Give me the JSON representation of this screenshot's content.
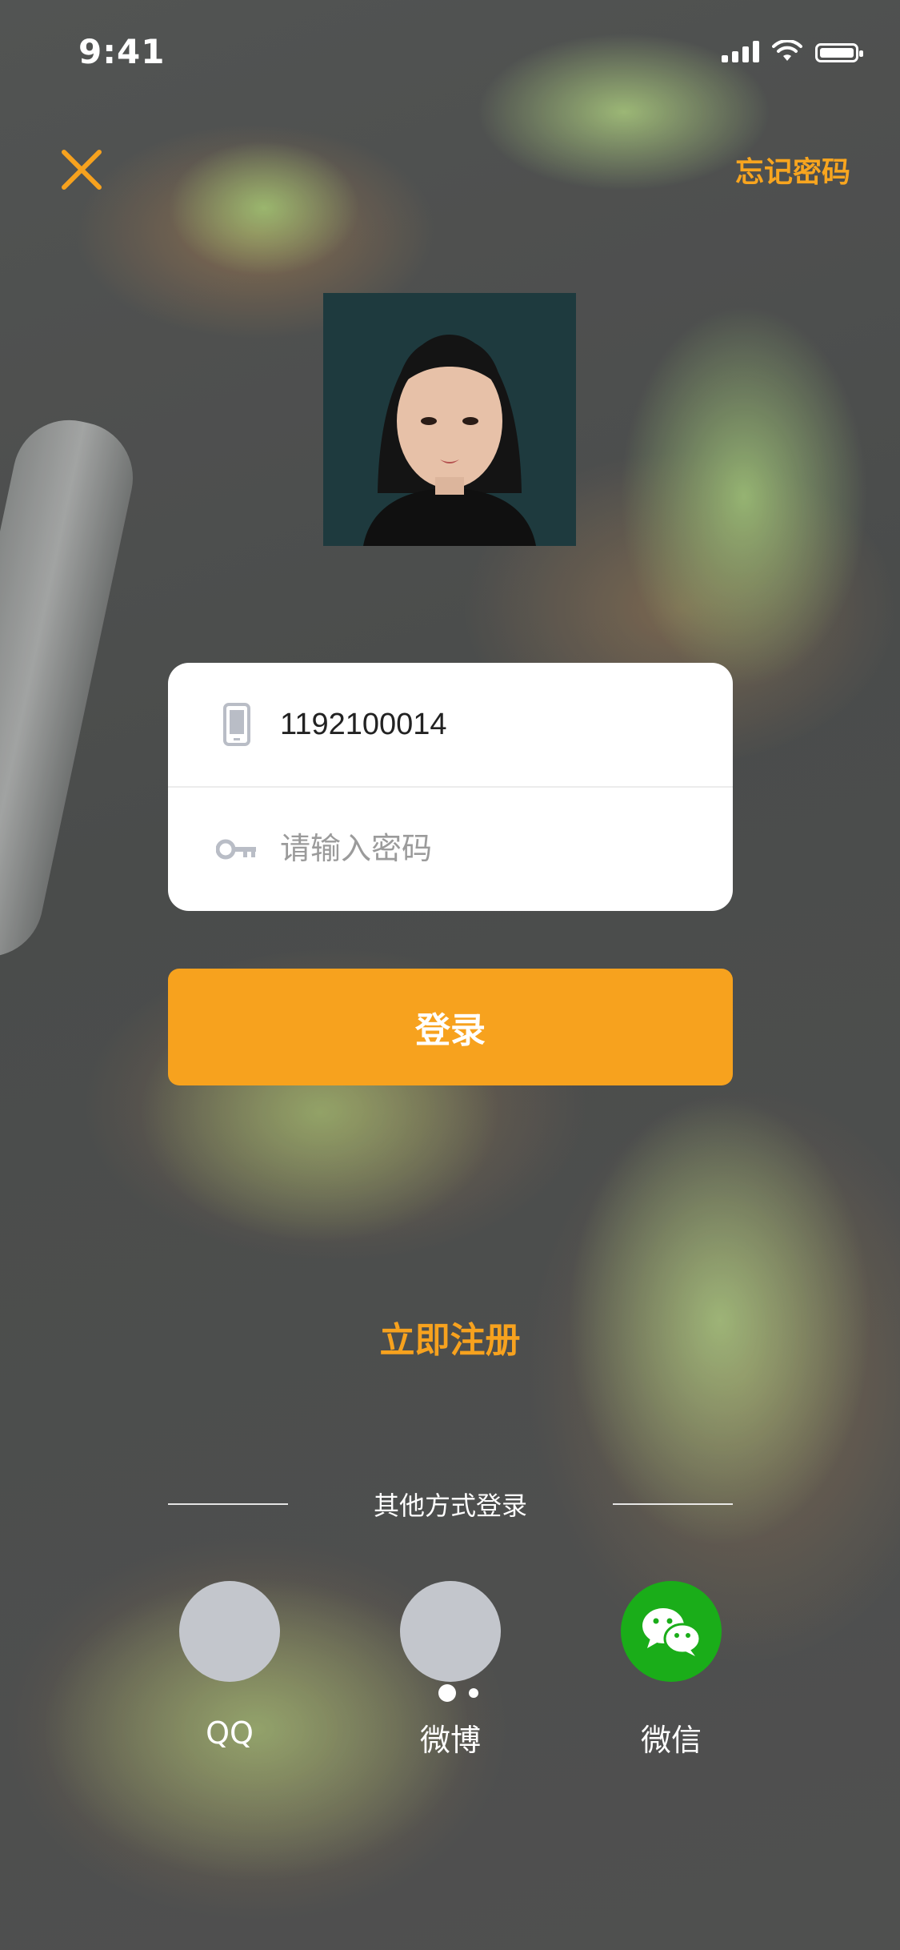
{
  "status_bar": {
    "time": "9:41"
  },
  "nav": {
    "forgot_password": "忘记密码"
  },
  "form": {
    "phone_value": "1192100014",
    "password_placeholder": "请输入密码"
  },
  "login_button": "登录",
  "register_link": "立即注册",
  "other_login": {
    "title": "其他方式登录",
    "options": [
      {
        "label": "QQ",
        "icon": "qq-icon"
      },
      {
        "label": "微博",
        "icon": "weibo-icon"
      },
      {
        "label": "微信",
        "icon": "wechat-icon"
      }
    ]
  },
  "colors": {
    "accent": "#f7a21e",
    "wechat_green": "#1aad19",
    "placeholder_circle": "#c3c6cc",
    "card_bg": "#ffffff"
  },
  "icons": {
    "close": "close-icon",
    "phone": "phone-icon",
    "key": "key-icon"
  }
}
